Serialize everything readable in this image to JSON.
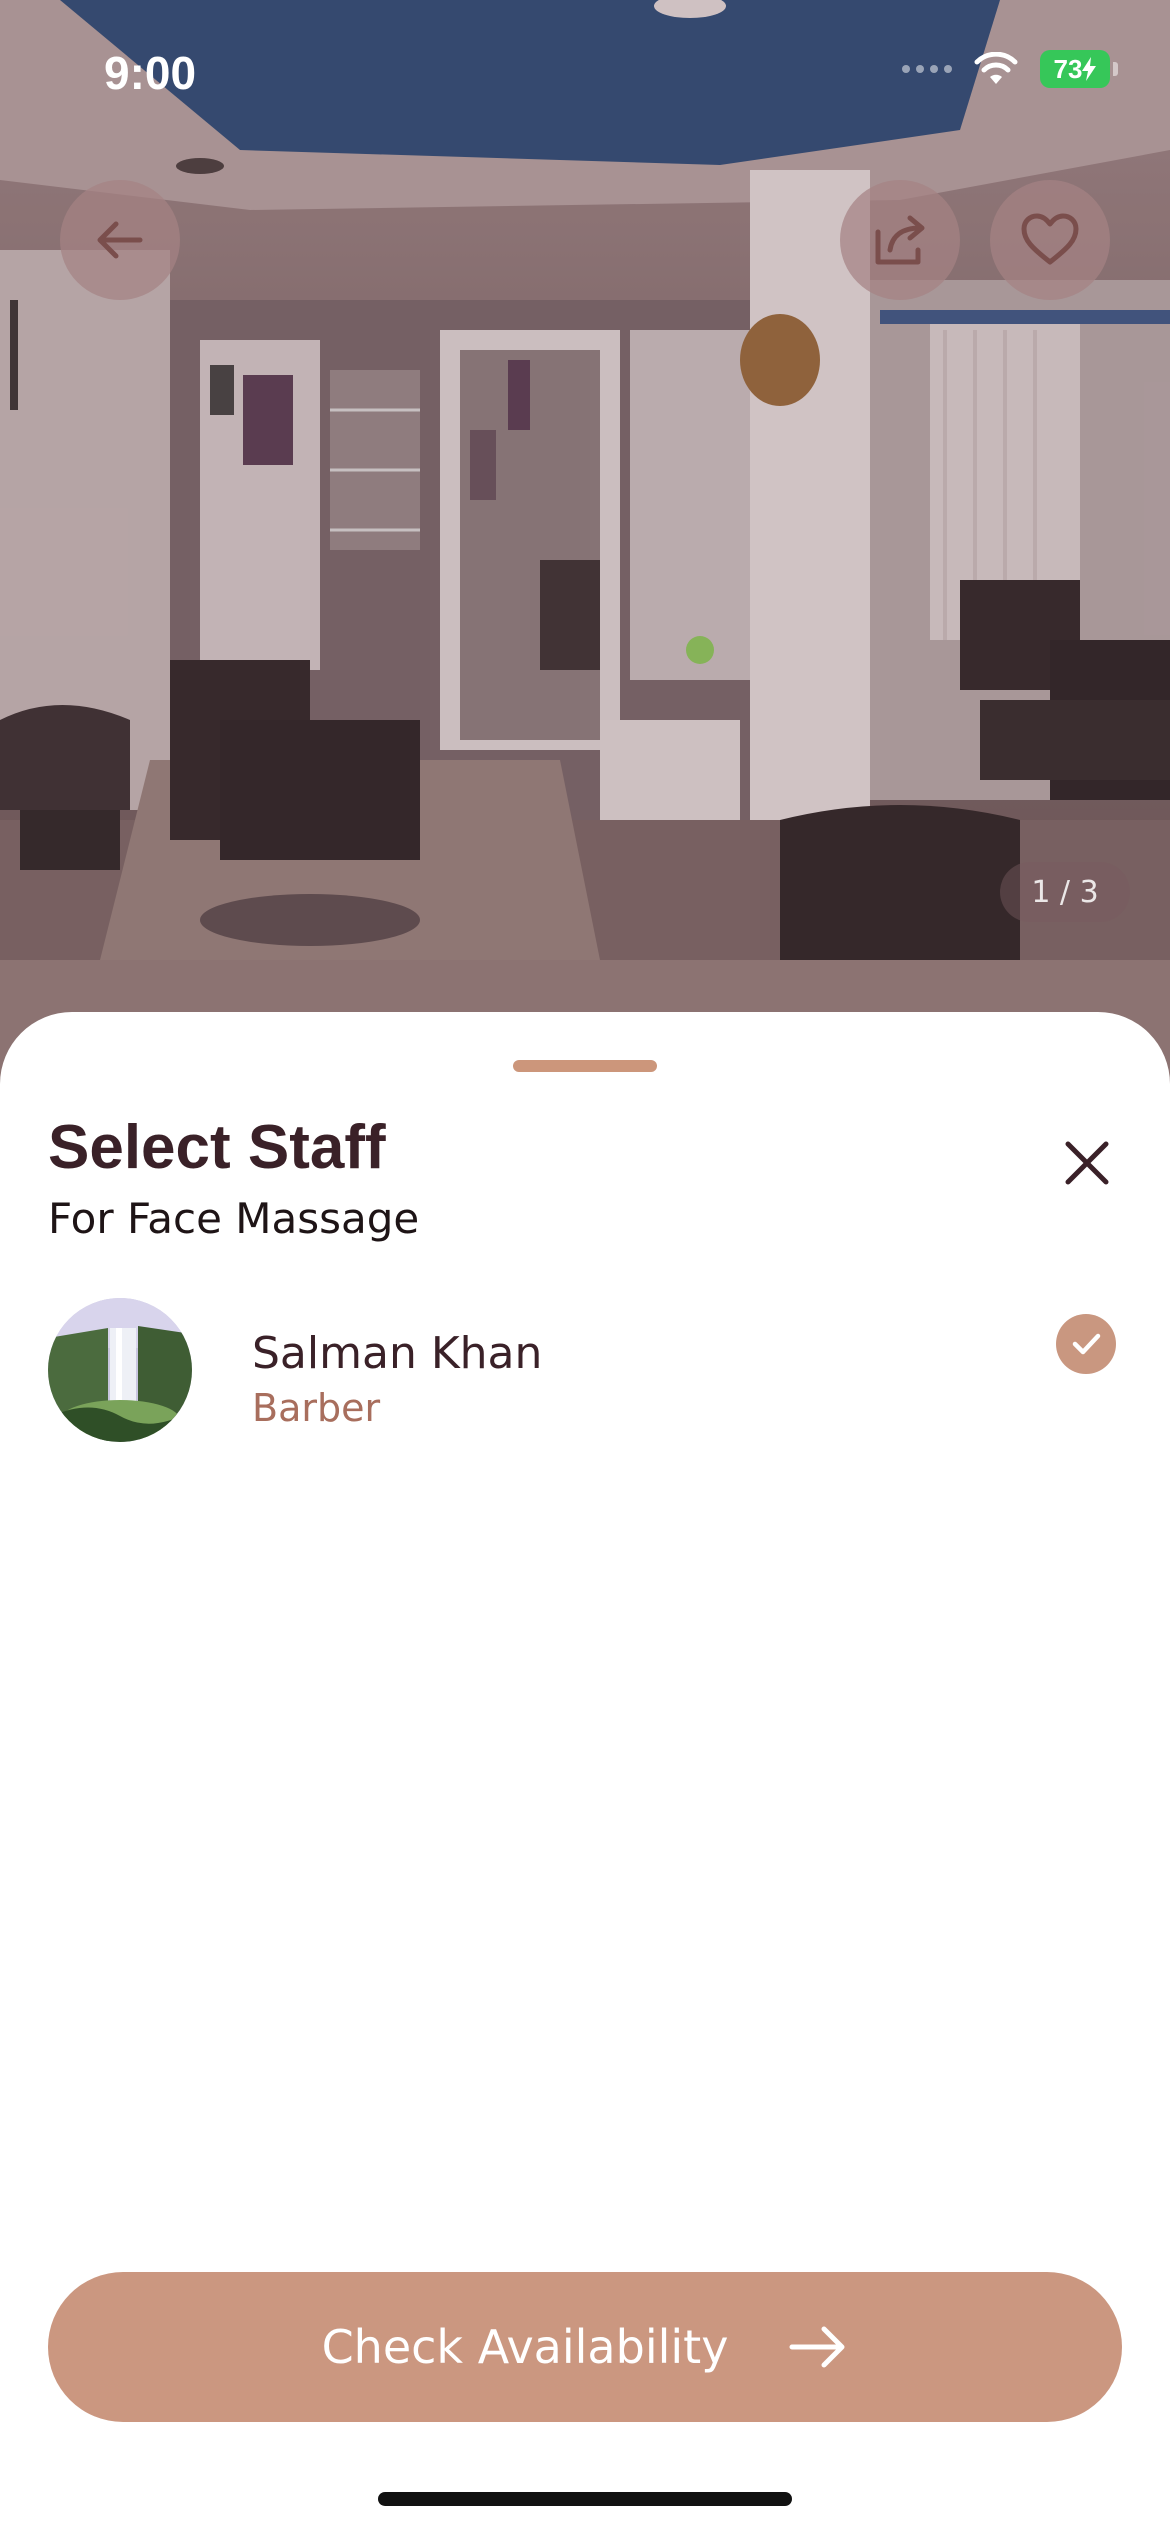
{
  "status_bar": {
    "time": "9:00",
    "battery": "73"
  },
  "gallery": {
    "counter": "1 / 3"
  },
  "hero_buttons": {
    "back_icon": "arrow-left-icon",
    "share_icon": "share-icon",
    "favorite_icon": "heart-icon"
  },
  "sheet": {
    "title": "Select Staff",
    "subtitle": "For Face Massage",
    "close_icon": "close-icon"
  },
  "staff": [
    {
      "name": "Salman Khan",
      "role": "Barber",
      "selected": true
    }
  ],
  "cta": {
    "label": "Check Availability",
    "icon": "arrow-right-icon"
  },
  "colors": {
    "accent": "#cb9780",
    "title": "#3a2128",
    "role": "#a86e5d",
    "battery": "#36c759"
  }
}
